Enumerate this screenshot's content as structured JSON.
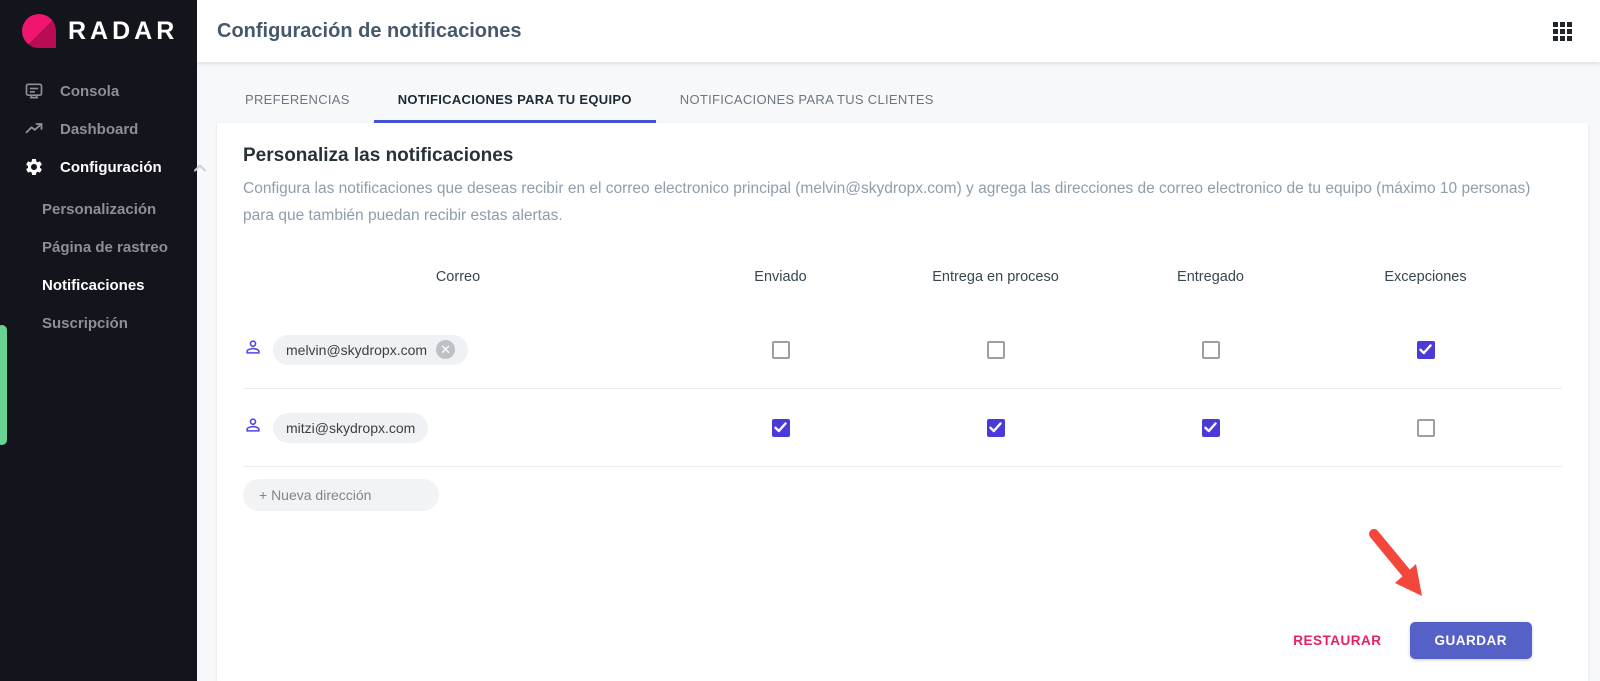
{
  "brand": {
    "name": "RADAR"
  },
  "sidebar": {
    "items": [
      {
        "label": "Consola"
      },
      {
        "label": "Dashboard"
      },
      {
        "label": "Configuración"
      }
    ],
    "config_children": [
      {
        "label": "Personalización"
      },
      {
        "label": "Página de rastreo"
      },
      {
        "label": "Notificaciones"
      },
      {
        "label": "Suscripción"
      }
    ]
  },
  "header": {
    "title": "Configuración de notificaciones"
  },
  "tabs": [
    {
      "label": "PREFERENCIAS",
      "active": false
    },
    {
      "label": "NOTIFICACIONES PARA TU EQUIPO",
      "active": true
    },
    {
      "label": "NOTIFICACIONES PARA TUS CLIENTES",
      "active": false
    }
  ],
  "main": {
    "heading": "Personaliza las notificaciones",
    "description": "Configura las notificaciones que deseas recibir en el correo electronico principal (melvin@skydropx.com) y agrega las direcciones de correo electronico de tu equipo (máximo 10 personas) para que también puedan recibir estas alertas."
  },
  "table": {
    "columns": [
      "Correo",
      "Enviado",
      "Entrega en proceso",
      "Entregado",
      "Excepciones"
    ],
    "rows": [
      {
        "email": "melvin@skydropx.com",
        "removable": true,
        "checks": [
          false,
          false,
          false,
          true
        ]
      },
      {
        "email": "mitzi@skydropx.com",
        "removable": false,
        "checks": [
          true,
          true,
          true,
          false
        ]
      }
    ]
  },
  "chip": {
    "remove_glyph": "✕"
  },
  "add_address": {
    "label": "+ Nueva dirección"
  },
  "footer": {
    "restore_label": "RESTAURAR",
    "save_label": "GUARDAR"
  },
  "colors": {
    "accent_checkbox": "#4a3bd8",
    "tab_underline": "#4353d6",
    "save_button": "#5561c7",
    "restore_pink": "#e91e63",
    "brand_pink": "#ee1566",
    "green_indicator": "#69d391",
    "arrow_red": "#f4473c"
  }
}
